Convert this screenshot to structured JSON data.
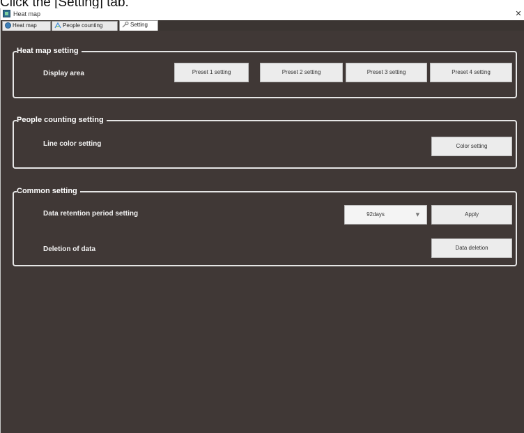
{
  "instruction": "Click the [Setting] tab.",
  "window": {
    "title": "Heat map",
    "close_glyph": "✕"
  },
  "tabs": [
    {
      "label": "Heat map",
      "icon": "globe-icon"
    },
    {
      "label": "People counting",
      "icon": "people-counting-icon"
    },
    {
      "label": "Setting",
      "icon": "wrench-icon",
      "active": true
    }
  ],
  "heat_map_setting": {
    "title": "Heat map setting",
    "display_area_label": "Display area",
    "preset_buttons": [
      "Preset 1 setting",
      "Preset 2 setting",
      "Preset 3 setting",
      "Preset 4 setting"
    ]
  },
  "people_counting_setting": {
    "title": "People counting setting",
    "line_color_label": "Line color setting",
    "color_button": "Color setting"
  },
  "common_setting": {
    "title": "Common setting",
    "retention_label": "Data retention period setting",
    "retention_value": "92days",
    "apply_button": "Apply",
    "deletion_label": "Deletion of data",
    "deletion_button": "Data deletion"
  },
  "colors": {
    "panel_background": "#403836",
    "group_border": "#e6e6e6",
    "button_background": "#ececec"
  }
}
